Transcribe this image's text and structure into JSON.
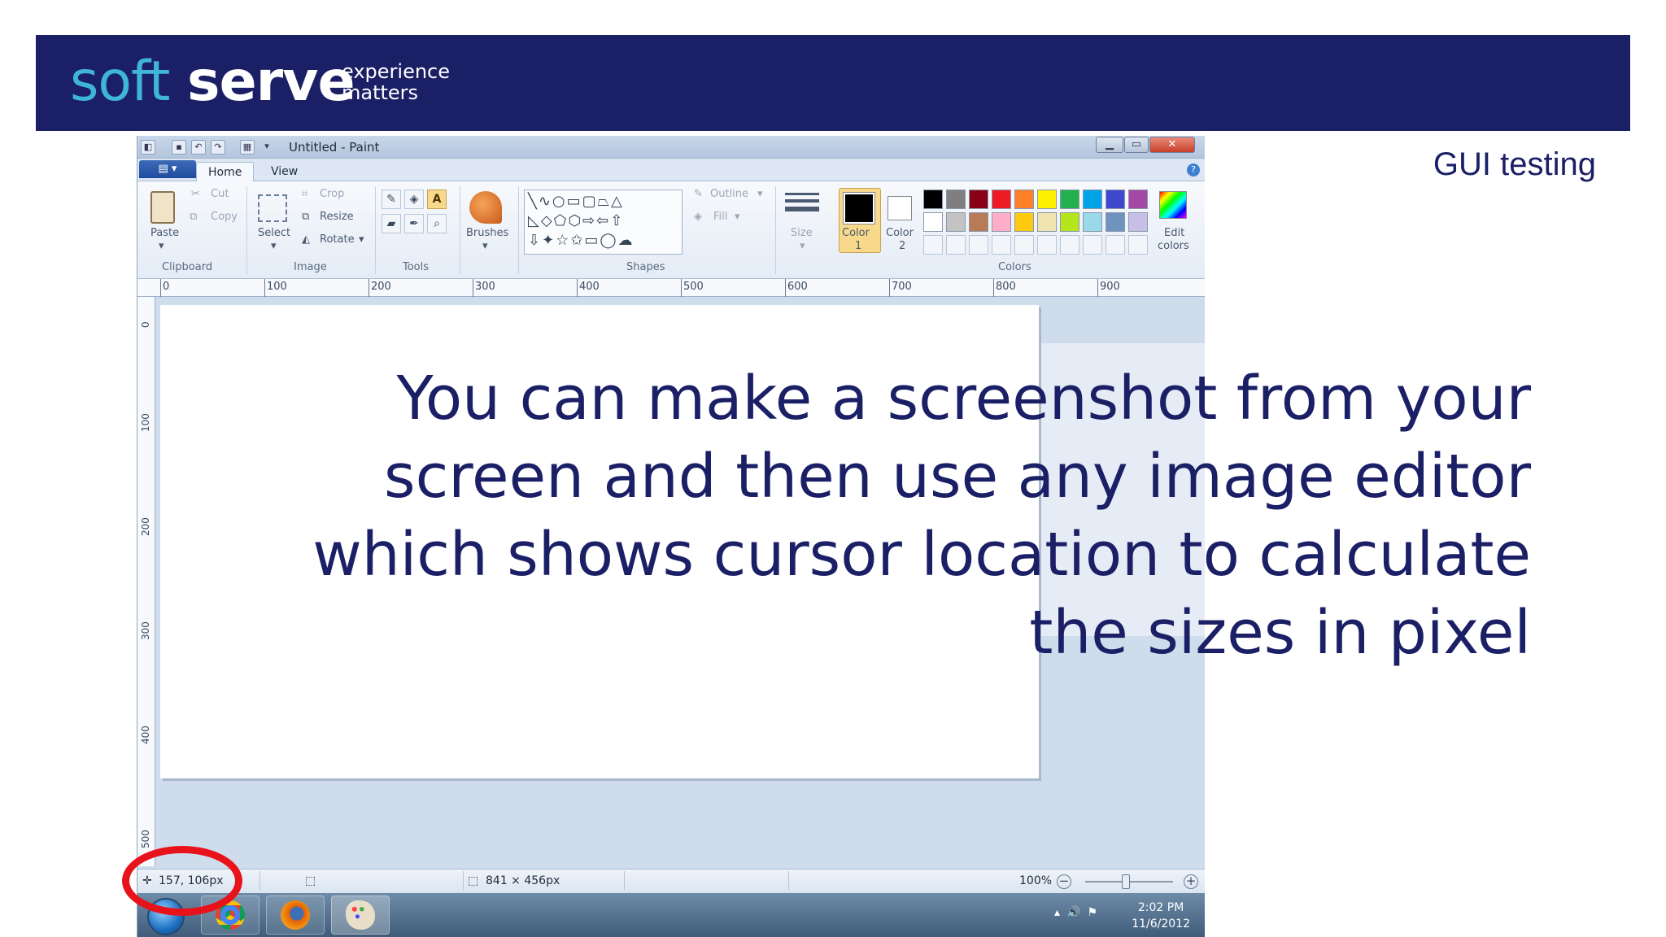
{
  "header": {
    "logo_soft": "soft",
    "logo_serve": "serve",
    "tagline_1": "experience",
    "tagline_2": "matters",
    "bg_color": "#1b1f66",
    "accent_color": "#3fb5d8"
  },
  "slide_title": "GUI testing",
  "main_text": "You can make a screenshot from your screen and then use any image editor which shows cursor location to calculate the sizes in pixel",
  "paint": {
    "window_title": "Untitled - Paint",
    "tabs": {
      "home": "Home",
      "view": "View"
    },
    "clipboard": {
      "paste": "Paste",
      "cut": "Cut",
      "copy": "Copy",
      "group": "Clipboard"
    },
    "image": {
      "select": "Select",
      "crop": "Crop",
      "resize": "Resize",
      "rotate": "Rotate",
      "group": "Image"
    },
    "tools": {
      "group": "Tools"
    },
    "brushes": {
      "label": "Brushes"
    },
    "shapes": {
      "group": "Shapes",
      "outline": "Outline",
      "fill": "Fill"
    },
    "size": {
      "label": "Size"
    },
    "colors": {
      "color1": "Color",
      "color1_num": "1",
      "color2": "Color",
      "color2_num": "2",
      "edit": "Edit",
      "edit2": "colors",
      "group": "Colors",
      "palette_row1": [
        "#000000",
        "#7f7f7f",
        "#880015",
        "#ed1c24",
        "#ff7f27",
        "#fff200",
        "#22b14c",
        "#00a2e8",
        "#3f48cc",
        "#a349a4"
      ],
      "palette_row2": [
        "#ffffff",
        "#c3c3c3",
        "#b97a57",
        "#ffaec9",
        "#ffc90e",
        "#efe4b0",
        "#b5e61d",
        "#99d9ea",
        "#7092be",
        "#c8bfe7"
      ]
    },
    "ruler_h": [
      "0",
      "100",
      "200",
      "300",
      "400",
      "500",
      "600",
      "700",
      "800",
      "900"
    ],
    "ruler_v": [
      "0",
      "100",
      "200",
      "300",
      "400",
      "500"
    ],
    "status": {
      "cursor_pos": "157, 106px",
      "canvas_size": "841 × 456px",
      "zoom": "100%"
    },
    "taskbar": {
      "time": "2:02 PM",
      "date": "11/6/2012"
    }
  }
}
